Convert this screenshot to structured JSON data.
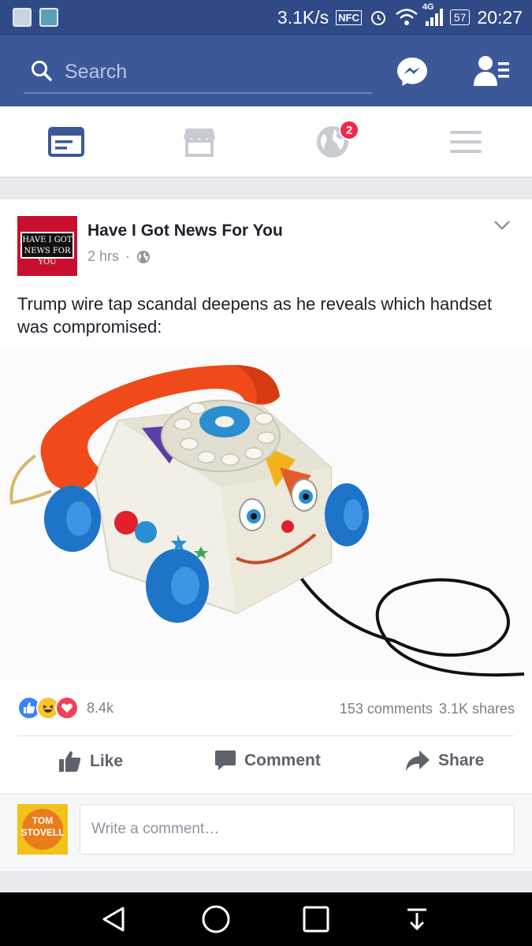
{
  "status_bar": {
    "speed": "3.1K/s",
    "nfc": "NFC",
    "network": "4G",
    "battery": "57",
    "time": "20:27"
  },
  "header": {
    "search_placeholder": "Search"
  },
  "tabs": {
    "notifications_badge": "2"
  },
  "post": {
    "page_name": "Have I Got News For You",
    "page_logo_text": "HAVE I GOT NEWS FOR YOU",
    "time": "2 hrs",
    "text": "Trump wire tap scandal deepens as he reveals which handset was compromised:",
    "reaction_count": "8.4k",
    "comments": "153 comments",
    "shares": "3.1K shares"
  },
  "actions": {
    "like": "Like",
    "comment": "Comment",
    "share": "Share"
  },
  "composer": {
    "avatar_text": "TOM STOVELL",
    "placeholder": "Write a comment…"
  },
  "colors": {
    "brand": "#3b5998",
    "status_bar": "#2f4a86",
    "badge": "#f02849"
  }
}
